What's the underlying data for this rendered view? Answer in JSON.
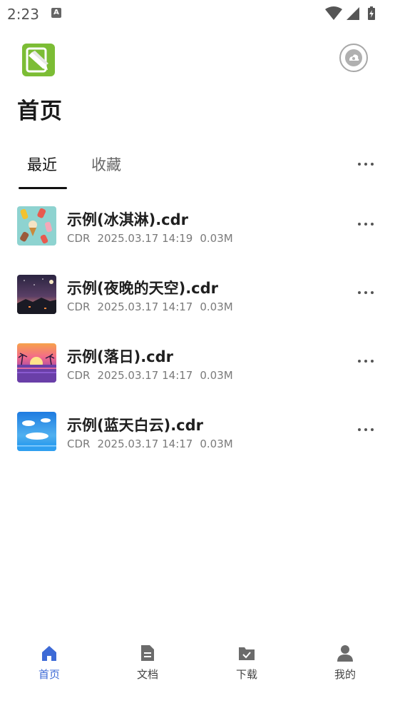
{
  "status": {
    "time": "2:23",
    "notification_glyph": "A"
  },
  "header": {
    "title": "首页"
  },
  "tabs": [
    {
      "label": "最近",
      "active": true
    },
    {
      "label": "收藏",
      "active": false
    }
  ],
  "files": [
    {
      "name": "示例(冰淇淋).cdr",
      "type": "CDR",
      "date": "2025.03.17 14:19",
      "size": "0.03M",
      "thumb": "ice-cream"
    },
    {
      "name": "示例(夜晚的天空).cdr",
      "type": "CDR",
      "date": "2025.03.17 14:17",
      "size": "0.03M",
      "thumb": "night-sky"
    },
    {
      "name": "示例(落日).cdr",
      "type": "CDR",
      "date": "2025.03.17 14:17",
      "size": "0.03M",
      "thumb": "sunset"
    },
    {
      "name": "示例(蓝天白云).cdr",
      "type": "CDR",
      "date": "2025.03.17 14:17",
      "size": "0.03M",
      "thumb": "blue-sky"
    }
  ],
  "nav": [
    {
      "label": "首页",
      "icon": "home-icon",
      "active": true
    },
    {
      "label": "文档",
      "icon": "document-icon",
      "active": false
    },
    {
      "label": "下载",
      "icon": "download-folder-icon",
      "active": false
    },
    {
      "label": "我的",
      "icon": "profile-icon",
      "active": false
    }
  ],
  "colors": {
    "accent": "#3d6ad6",
    "logo": "#7cbd35",
    "inactive_icon": "#6b6b6b"
  }
}
